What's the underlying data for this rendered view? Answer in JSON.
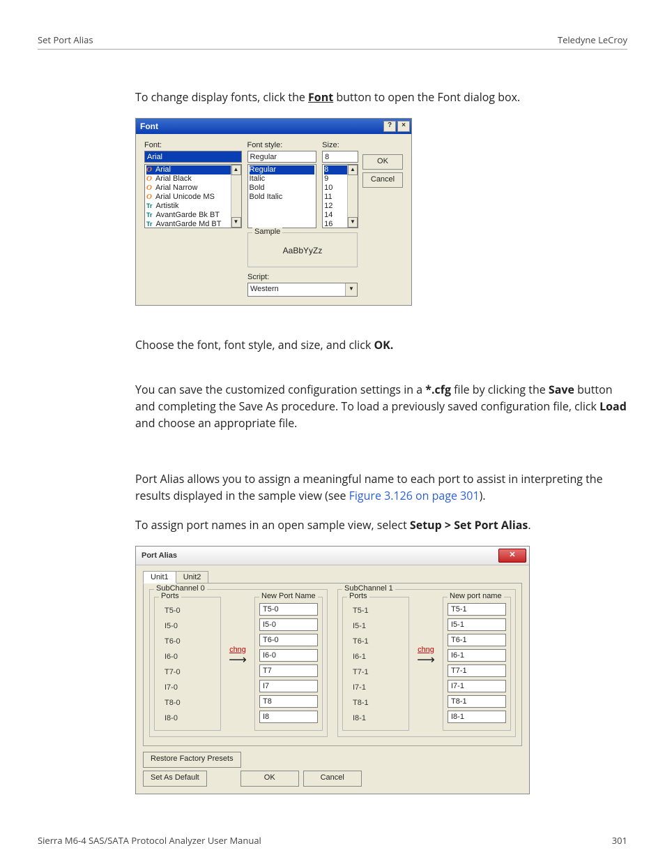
{
  "header": {
    "left": "Set Port Alias",
    "right": "Teledyne LeCroy"
  },
  "intro": {
    "p1_pre": "To change display fonts, click the ",
    "p1_bold": "Font",
    "p1_post": " button to open the Font dialog box."
  },
  "font_dialog": {
    "title": "Font",
    "help": "?",
    "close": "×",
    "labels": {
      "font": "Font:",
      "style": "Font style:",
      "size": "Size:",
      "sample": "Sample",
      "sample_text": "AaBbYyZz",
      "script": "Script:"
    },
    "inputs": {
      "font": "Arial",
      "style": "Regular",
      "size": "8",
      "script": "Western"
    },
    "fonts": [
      "Arial",
      "Arial Black",
      "Arial Narrow",
      "Arial Unicode MS",
      "Artistik",
      "AvantGarde Bk BT",
      "AvantGarde Md BT"
    ],
    "styles": [
      "Regular",
      "Italic",
      "Bold",
      "Bold Italic"
    ],
    "sizes": [
      "8",
      "9",
      "10",
      "11",
      "12",
      "14",
      "16"
    ],
    "buttons": {
      "ok": "OK",
      "cancel": "Cancel"
    }
  },
  "mid": {
    "p2_pre": "Choose the font, font style, and size, and click ",
    "p2_bold": "OK.",
    "p3_pre": "You can save the customized configuration settings in a ",
    "p3_b1": "*.cfg",
    "p3_mid": " file by clicking the ",
    "p3_b2": "Save",
    "p3_mid2": " button and completing the Save As procedure. To load a previously saved configuration file, click ",
    "p3_b3": "Load",
    "p3_end": " and choose an appropriate file.",
    "p4_pre": "Port Alias allows you to assign a meaningful name to each port to assist in interpreting the results displayed in the sample view (see ",
    "p4_link": "Figure 3.126 on page 301",
    "p4_post": ").",
    "p5_pre": "To assign port names in an open sample view, select ",
    "p5_bold": "Setup > Set Port Alias",
    "p5_post": "."
  },
  "port_dialog": {
    "title": "Port Alias",
    "tabs": [
      "Unit1",
      "Unit2"
    ],
    "sub_labels": [
      "SubChannel 0",
      "SubChannel 1"
    ],
    "ports_label": "Ports",
    "newname_labels": [
      "New Port Name",
      "New port name"
    ],
    "chng": "chng",
    "sub0": {
      "ports": [
        "T5-0",
        "I5-0",
        "T6-0",
        "I6-0",
        "T7-0",
        "I7-0",
        "T8-0",
        "I8-0"
      ],
      "names": [
        "T5-0",
        "I5-0",
        "T6-0",
        "I6-0",
        "T7",
        "I7",
        "T8",
        "I8"
      ]
    },
    "sub1": {
      "ports": [
        "T5-1",
        "I5-1",
        "T6-1",
        "I6-1",
        "T7-1",
        "I7-1",
        "T8-1",
        "I8-1"
      ],
      "names": [
        "T5-1",
        "I5-1",
        "T6-1",
        "I6-1",
        "T7-1",
        "I7-1",
        "T8-1",
        "I8-1"
      ]
    },
    "buttons": {
      "restore": "Restore Factory Presets",
      "default": "Set As Default",
      "ok": "OK",
      "cancel": "Cancel"
    }
  },
  "footer": {
    "left": "Sierra M6-4 SAS/SATA Protocol Analyzer User Manual",
    "right": "301"
  }
}
